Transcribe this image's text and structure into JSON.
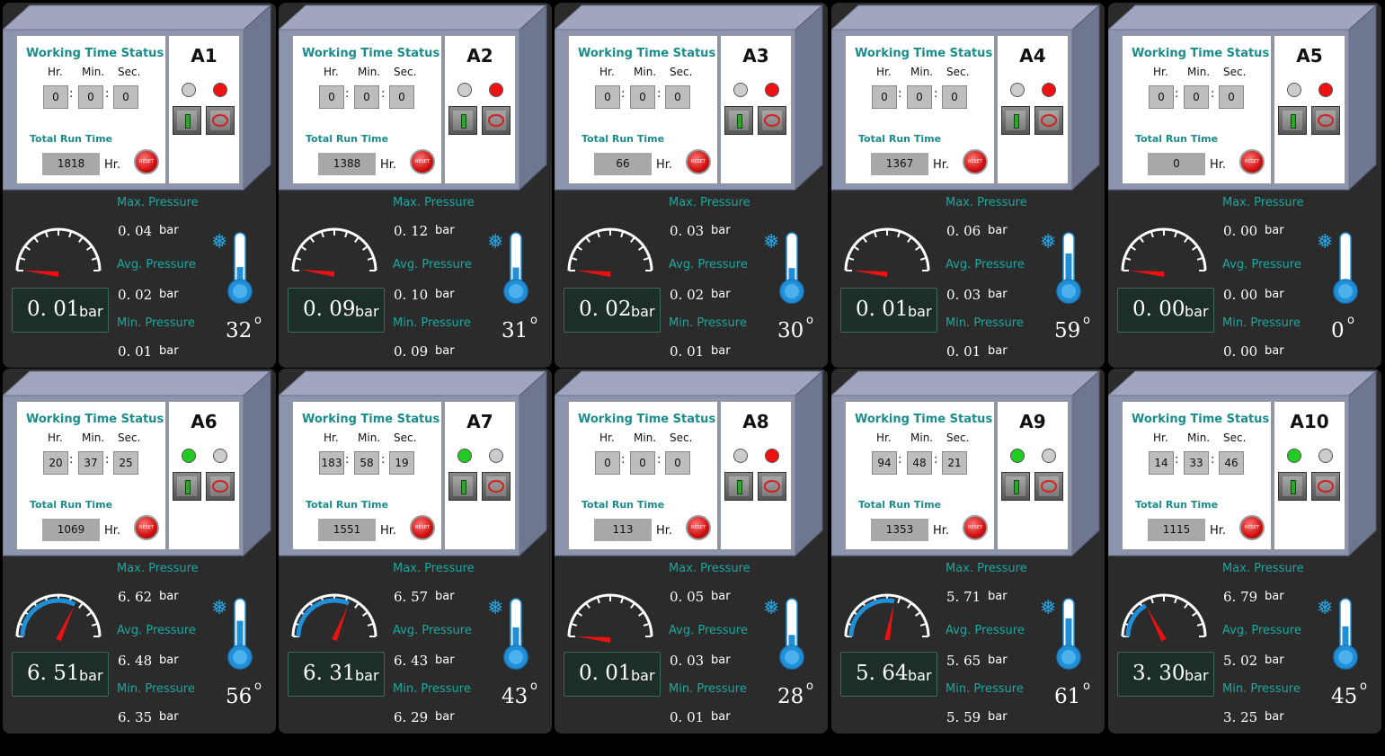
{
  "labels": {
    "working_time_status": "Working Time Status",
    "hr": "Hr.",
    "min": "Min.",
    "sec": "Sec.",
    "total_run_time": "Total Run Time",
    "hr_unit": "Hr.",
    "reset": "RESET",
    "max_pressure": "Max. Pressure",
    "avg_pressure": "Avg. Pressure",
    "min_pressure": "Min. Pressure",
    "bar": "bar",
    "degree": "o"
  },
  "colors": {
    "label_teal": "#18a8a0",
    "led_green": "#22cc22",
    "led_red": "#ee1111",
    "led_grey": "#cccccc",
    "gauge_blue": "#1f8fd8",
    "needle_red": "#ee1111"
  },
  "units": [
    {
      "name": "A1",
      "hr": "0",
      "min": "0",
      "sec": "0",
      "total": "1818",
      "running": false,
      "max": "0. 04",
      "avg": "0. 02",
      "minp": "0. 01",
      "current": "0. 01",
      "gauge_value": 0.01,
      "temp": "32",
      "temp_level": 0.32
    },
    {
      "name": "A2",
      "hr": "0",
      "min": "0",
      "sec": "0",
      "total": "1388",
      "running": false,
      "max": "0. 12",
      "avg": "0. 10",
      "minp": "0. 09",
      "current": "0. 09",
      "gauge_value": 0.09,
      "temp": "31",
      "temp_level": 0.31
    },
    {
      "name": "A3",
      "hr": "0",
      "min": "0",
      "sec": "0",
      "total": "66",
      "running": false,
      "max": "0. 03",
      "avg": "0. 02",
      "minp": "0. 01",
      "current": "0. 02",
      "gauge_value": 0.02,
      "temp": "30",
      "temp_level": 0.3
    },
    {
      "name": "A4",
      "hr": "0",
      "min": "0",
      "sec": "0",
      "total": "1367",
      "running": false,
      "max": "0. 06",
      "avg": "0. 03",
      "minp": "0. 01",
      "current": "0. 01",
      "gauge_value": 0.01,
      "temp": "59",
      "temp_level": 0.59
    },
    {
      "name": "A5",
      "hr": "0",
      "min": "0",
      "sec": "0",
      "total": "0",
      "running": false,
      "max": "0. 00",
      "avg": "0. 00",
      "minp": "0. 00",
      "current": "0. 00",
      "gauge_value": 0.0,
      "temp": "0",
      "temp_level": 0.0
    },
    {
      "name": "A6",
      "hr": "20",
      "min": "37",
      "sec": "25",
      "total": "1069",
      "running": true,
      "max": "6. 62",
      "avg": "6. 48",
      "minp": "6. 35",
      "current": "6. 51",
      "gauge_value": 6.51,
      "temp": "56",
      "temp_level": 0.56
    },
    {
      "name": "A7",
      "hr": "183",
      "min": "58",
      "sec": "19",
      "total": "1551",
      "running": true,
      "max": "6. 57",
      "avg": "6. 43",
      "minp": "6. 29",
      "current": "6. 31",
      "gauge_value": 6.31,
      "temp": "43",
      "temp_level": 0.43
    },
    {
      "name": "A8",
      "hr": "0",
      "min": "0",
      "sec": "0",
      "total": "113",
      "running": false,
      "max": "0. 05",
      "avg": "0. 03",
      "minp": "0. 01",
      "current": "0. 01",
      "gauge_value": 0.01,
      "temp": "28",
      "temp_level": 0.28
    },
    {
      "name": "A9",
      "hr": "94",
      "min": "48",
      "sec": "21",
      "total": "1353",
      "running": true,
      "max": "5. 71",
      "avg": "5. 65",
      "minp": "5. 59",
      "current": "5. 64",
      "gauge_value": 5.64,
      "temp": "61",
      "temp_level": 0.61
    },
    {
      "name": "A10",
      "hr": "14",
      "min": "33",
      "sec": "46",
      "total": "1115",
      "running": true,
      "max": "6. 79",
      "avg": "5. 02",
      "minp": "3. 25",
      "current": "3. 30",
      "gauge_value": 3.3,
      "temp": "45",
      "temp_level": 0.45
    }
  ]
}
